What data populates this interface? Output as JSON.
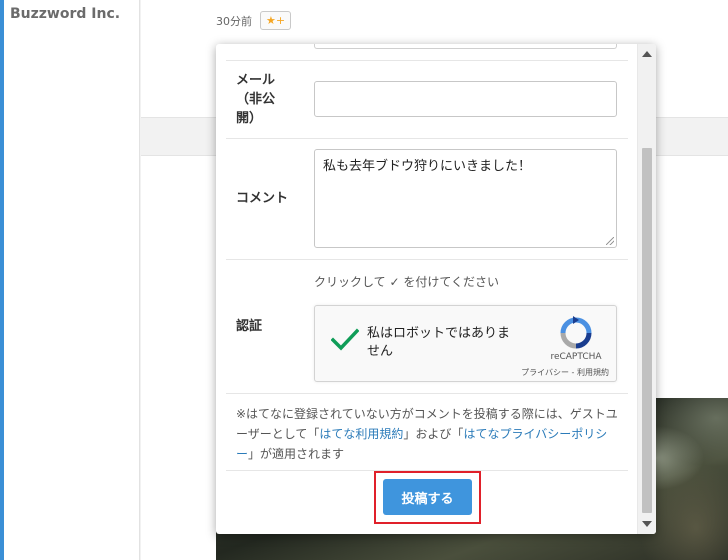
{
  "blog": {
    "name": "Buzzword Inc."
  },
  "entry": {
    "time_ago": "30分前",
    "star_button": "★+"
  },
  "comment_form": {
    "mail_label_line1": "メール",
    "mail_label_line2": "（非公",
    "mail_label_line3": "開）",
    "mail_value": "",
    "comment_label": "コメント",
    "comment_value": "私も去年ブドウ狩りにいきました！",
    "auth_label": "認証",
    "auth_hint": "クリックして ✓ を付けてください",
    "captcha": {
      "checkbox_text": "私はロボットではありません",
      "brand": "reCAPTCHA",
      "privacy": "プライバシー",
      "separator": " - ",
      "terms": "利用規約"
    },
    "notice": {
      "part1": "※はてなに登録されていない方がコメントを投稿する際には、ゲストユーザーとして「",
      "link1": "はてな利用規約",
      "part2": "」および「",
      "link2": "はてなプライバシーポリシー",
      "part3": "」が適用されます"
    },
    "submit_label": "投稿する"
  },
  "colors": {
    "accent": "#3f95dd",
    "highlight": "#e0202a",
    "check": "#0f9d58"
  }
}
